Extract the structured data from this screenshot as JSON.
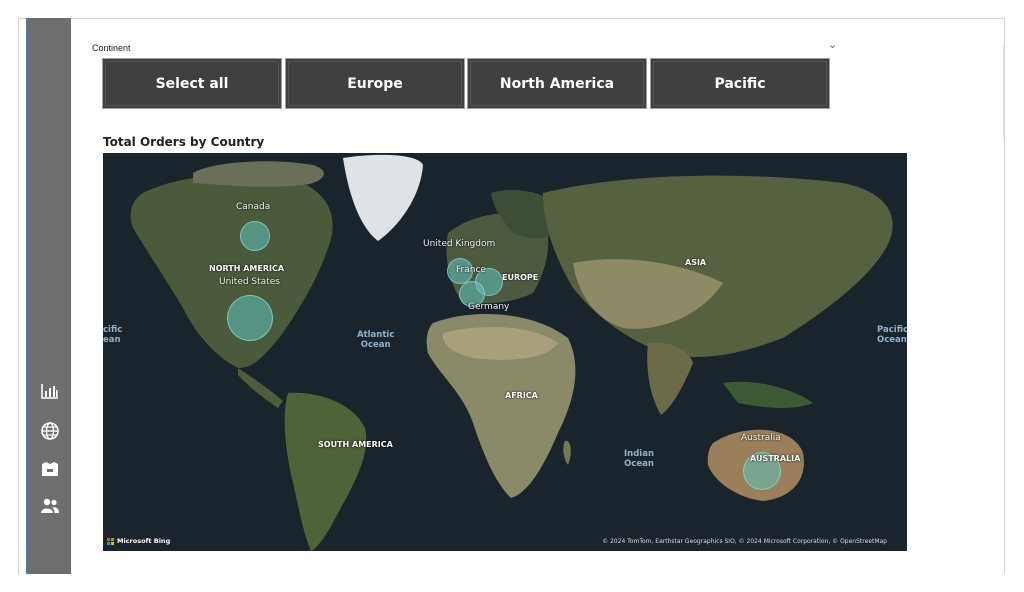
{
  "slicer": {
    "title": "Continent",
    "buttons": [
      "Select all",
      "Europe",
      "North America",
      "Pacific"
    ]
  },
  "map": {
    "title": "Total Orders by Country",
    "countries": [
      {
        "name": "Canada",
        "orders_bubble": "small"
      },
      {
        "name": "United States",
        "orders_bubble": "large"
      },
      {
        "name": "United Kingdom",
        "orders_bubble": "small"
      },
      {
        "name": "France",
        "orders_bubble": "small"
      },
      {
        "name": "Germany",
        "orders_bubble": "medium"
      },
      {
        "name": "Australia",
        "orders_bubble": "medium"
      }
    ],
    "regions": [
      "NORTH AMERICA",
      "SOUTH AMERICA",
      "EUROPE",
      "AFRICA",
      "ASIA",
      "AUSTRALIA"
    ],
    "oceans": {
      "atlantic": "Atlantic\nOcean",
      "indian": "Indian\nOcean",
      "pacific_left": "cific\nean",
      "pacific_right": "Pacific\nOcean"
    },
    "provider": "Microsoft Bing",
    "credit": "© 2024 TomTom, Earthstar Geographics SIO, © 2024 Microsoft Corporation, © OpenStreetMap"
  },
  "rail": {
    "icons": [
      "bar-chart-icon",
      "globe-icon",
      "box-icon",
      "people-icon"
    ]
  },
  "colors": {
    "button_bg": "#404040",
    "rail_bg": "#6e6e6e",
    "bubble": "#5fc4be",
    "ocean": "#1a242d"
  }
}
